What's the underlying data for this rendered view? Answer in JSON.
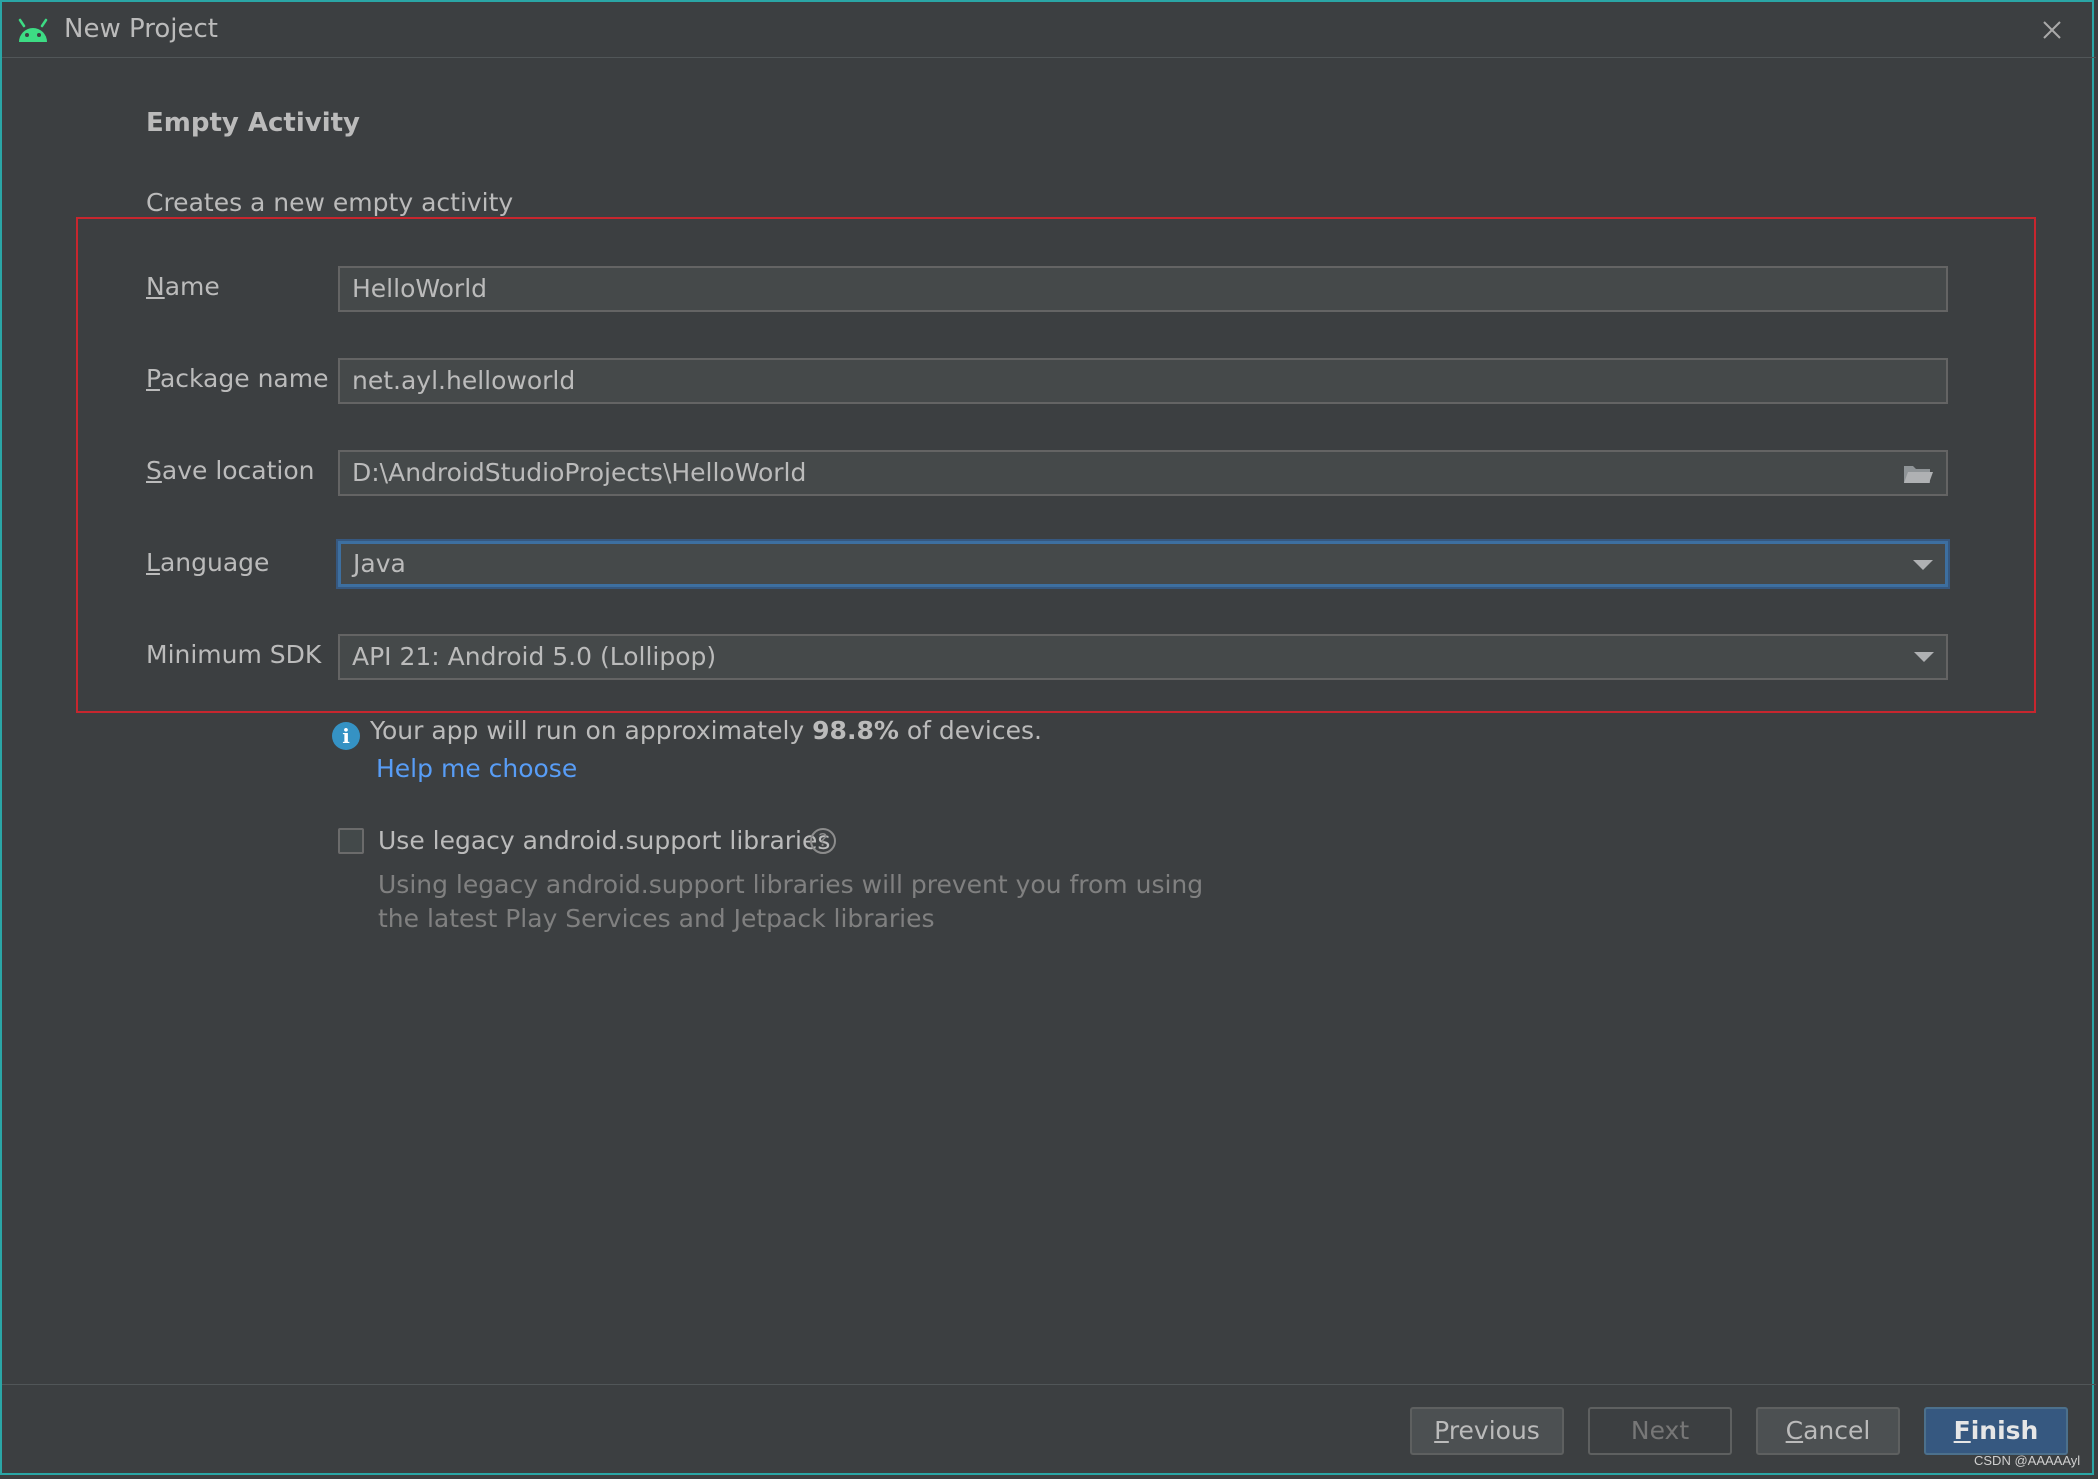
{
  "window": {
    "title": "New Project",
    "app_icon": "android-icon",
    "close_icon": "close-icon"
  },
  "template": {
    "heading": "Empty Activity",
    "description": "Creates a new empty activity"
  },
  "form": {
    "name": {
      "label": "Name",
      "mnemonic": "N",
      "rest": "ame",
      "value": "HelloWorld"
    },
    "package": {
      "label": "Package name",
      "mnemonic": "P",
      "rest": "ackage name",
      "value": "net.ayl.helloworld"
    },
    "location": {
      "label": "Save location",
      "mnemonic": "S",
      "rest": "ave location",
      "value": "D:\\AndroidStudioProjects\\HelloWorld",
      "icon": "folder-icon"
    },
    "language": {
      "label": "Language",
      "mnemonic": "L",
      "rest": "anguage",
      "value": "Java"
    },
    "min_sdk": {
      "label": "Minimum SDK",
      "value": "API 21: Android 5.0 (Lollipop)"
    }
  },
  "info": {
    "prefix": "Your app will run on approximately ",
    "percent": "98.8%",
    "suffix": " of devices.",
    "help_link": "Help me choose"
  },
  "legacy": {
    "checked": false,
    "label": "Use legacy android.support libraries",
    "help_line1": "Using legacy android.support libraries will prevent you from using",
    "help_line2": "the latest Play Services and Jetpack libraries"
  },
  "buttons": {
    "previous": {
      "mnemonic": "P",
      "rest": "revious"
    },
    "next": "Next",
    "cancel": {
      "mnemonic": "C",
      "rest": "ancel"
    },
    "finish": {
      "mnemonic": "F",
      "rest": "inish"
    }
  },
  "watermark": "CSDN @AAAAAyl",
  "colors": {
    "background": "#3c3f41",
    "accent": "#365880",
    "link": "#589df6",
    "highlight_border": "#c7262e",
    "android_green": "#3ddc84"
  }
}
